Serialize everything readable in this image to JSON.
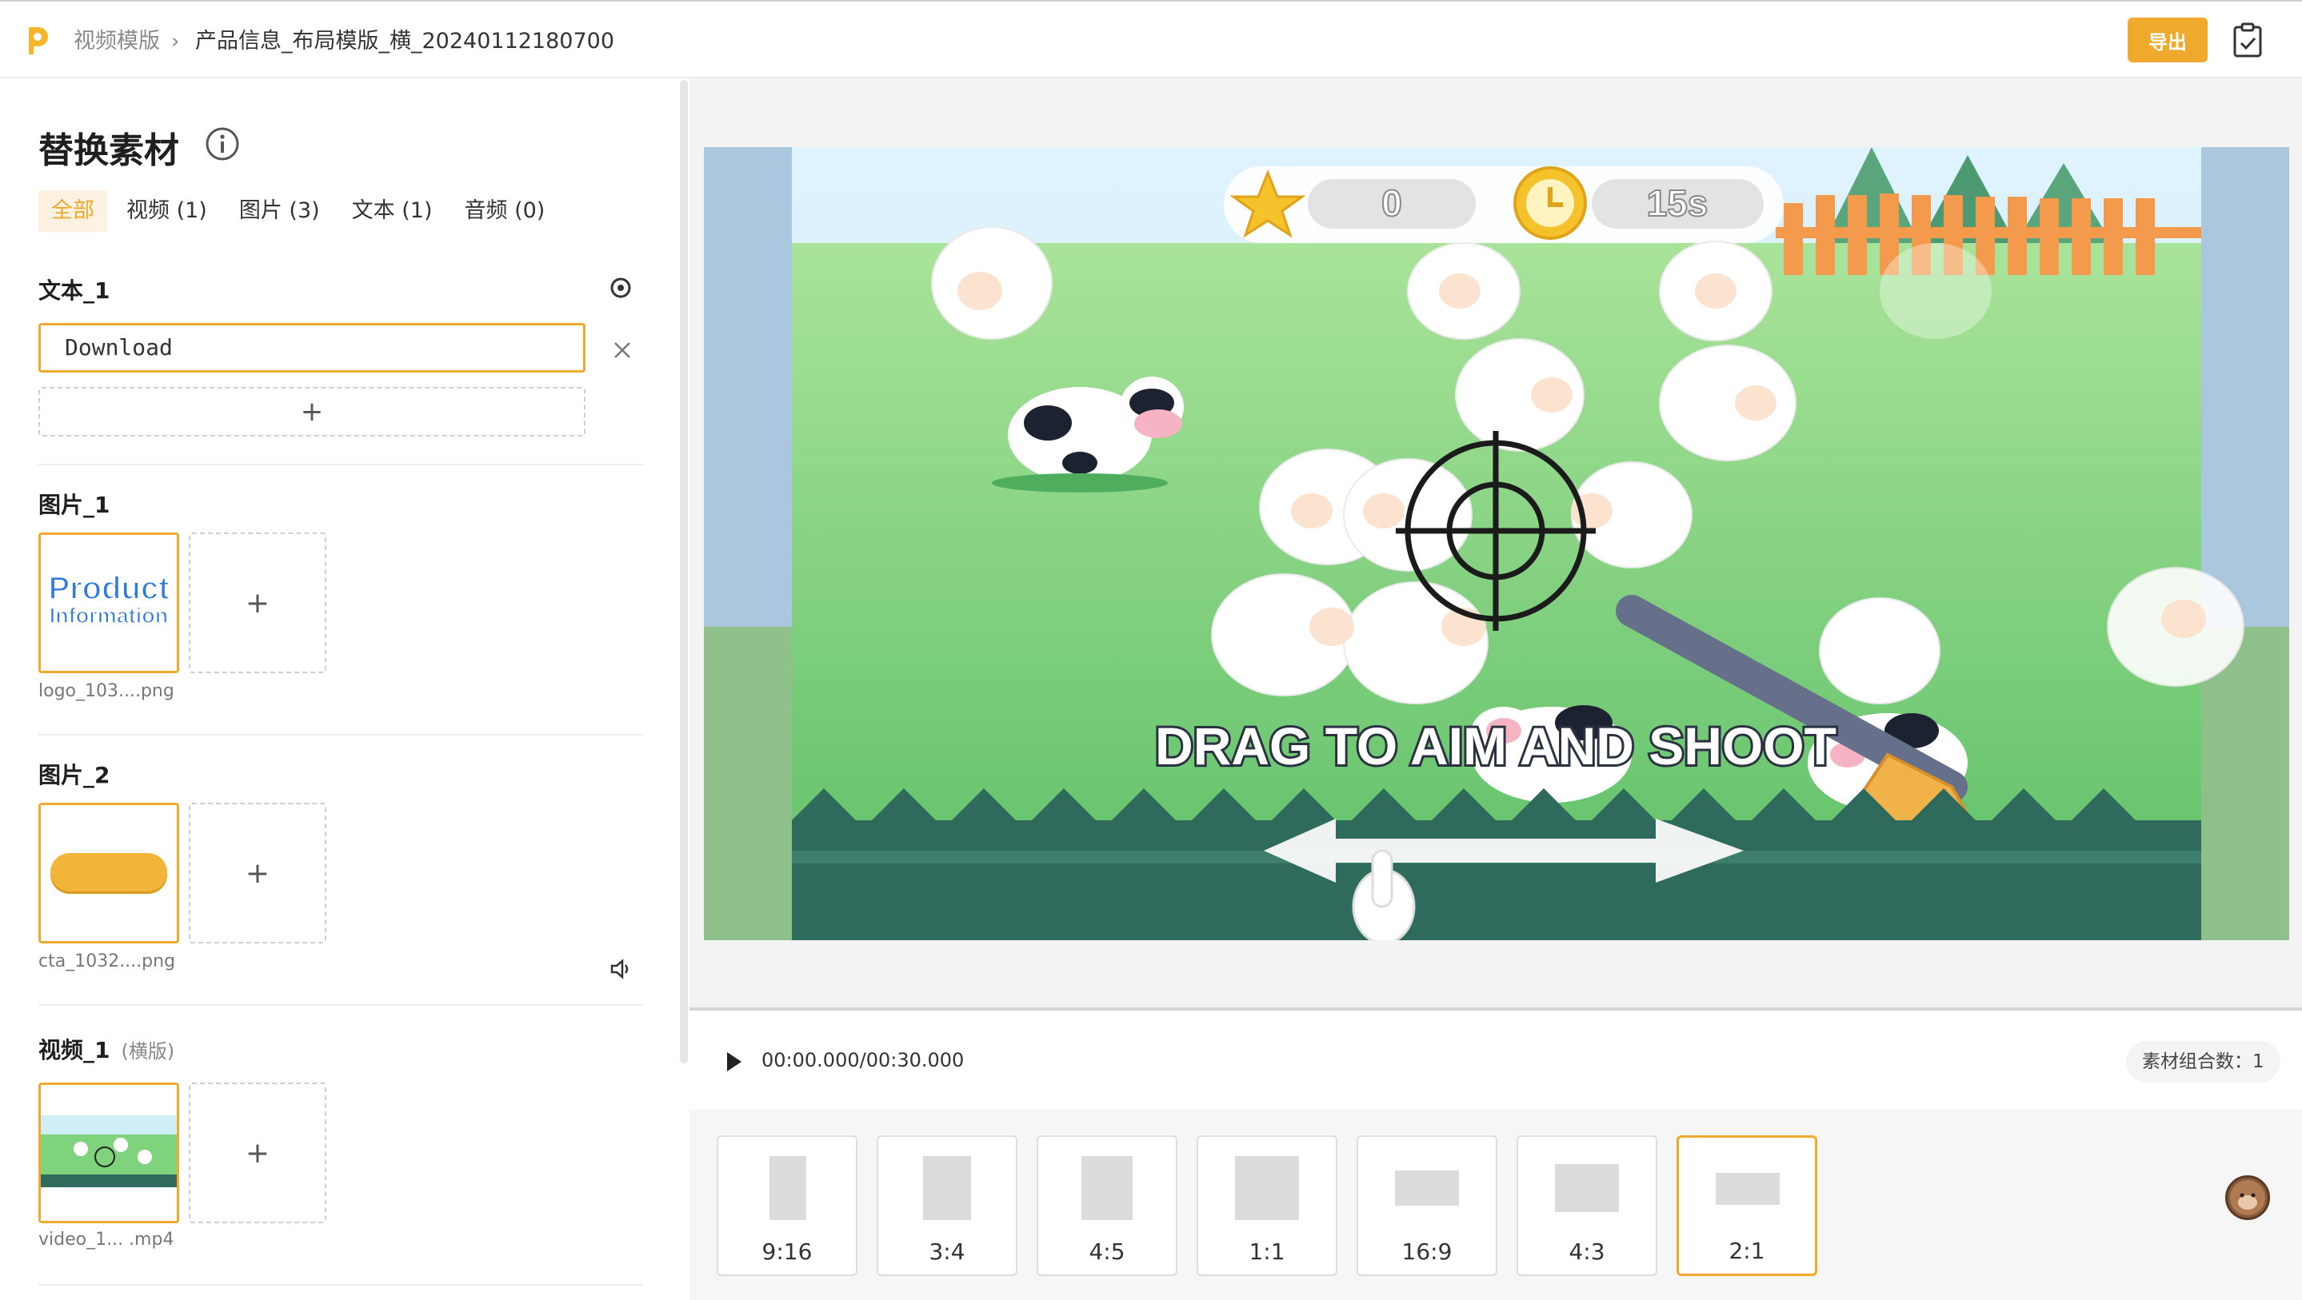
{
  "header": {
    "breadcrumb_root": "视频模版",
    "breadcrumb_current": "产品信息_布局模版_横_20240112180700",
    "export_label": "导出"
  },
  "panel": {
    "title": "替换素材",
    "tabs": [
      {
        "label": "全部",
        "active": true
      },
      {
        "label": "视频 (1)",
        "active": false
      },
      {
        "label": "图片 (3)",
        "active": false
      },
      {
        "label": "文本 (1)",
        "active": false
      },
      {
        "label": "音频 (0)",
        "active": false
      }
    ],
    "text_section": {
      "label": "文本_1",
      "value": "Download"
    },
    "image_sections": [
      {
        "label": "图片_1",
        "file": "logo_103....png",
        "logo_line1": "Product",
        "logo_line2": "Information"
      },
      {
        "label": "图片_2",
        "file": "cta_1032....png"
      }
    ],
    "video_section": {
      "label": "视频_1",
      "note": "(横版)",
      "file": "video_1... .mp4"
    }
  },
  "preview": {
    "score": "0",
    "timer": "15s",
    "caption": "DRAG TO AIM AND SHOOT"
  },
  "player": {
    "timecode": "00:00.000/00:30.000",
    "combo_count": "素材组合数：1"
  },
  "ratios": [
    {
      "label": "9:16",
      "active": false
    },
    {
      "label": "3:4",
      "active": false
    },
    {
      "label": "4:5",
      "active": false
    },
    {
      "label": "1:1",
      "active": false
    },
    {
      "label": "16:9",
      "active": false
    },
    {
      "label": "4:3",
      "active": false
    },
    {
      "label": "2:1",
      "active": true
    }
  ],
  "colors": {
    "accent": "#efaa2e",
    "grass": "#6cc86a",
    "fence": "#2f6b5c"
  },
  "icons": [
    "app-logo-icon",
    "chevron-right-icon",
    "clipboard-check-icon",
    "info-icon",
    "gear-icon",
    "close-icon",
    "plus-icon",
    "speaker-icon",
    "play-icon",
    "avatar"
  ]
}
